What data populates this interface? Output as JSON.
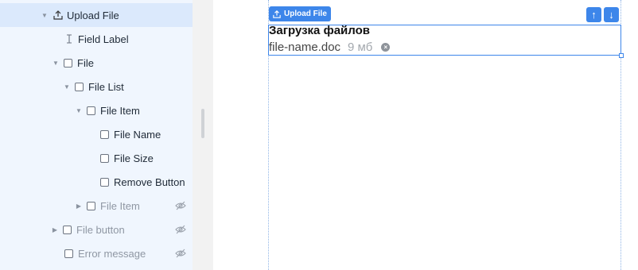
{
  "tree": {
    "items": [
      {
        "label": "Upload File",
        "icon": "upload-icon",
        "caret": true,
        "selected": true,
        "muted": false,
        "hidden": false
      },
      {
        "label": "Field Label",
        "icon": "text-cursor-icon",
        "caret": false,
        "selected": false,
        "muted": false,
        "hidden": false
      },
      {
        "label": "File",
        "icon": "box-icon",
        "caret": true,
        "selected": false,
        "muted": false,
        "hidden": false
      },
      {
        "label": "File List",
        "icon": "box-icon",
        "caret": true,
        "selected": false,
        "muted": false,
        "hidden": false
      },
      {
        "label": "File Item",
        "icon": "box-icon",
        "caret": true,
        "selected": false,
        "muted": false,
        "hidden": false
      },
      {
        "label": "File Name",
        "icon": "box-icon",
        "caret": false,
        "selected": false,
        "muted": false,
        "hidden": false
      },
      {
        "label": "File Size",
        "icon": "box-icon",
        "caret": false,
        "selected": false,
        "muted": false,
        "hidden": false
      },
      {
        "label": "Remove Button",
        "icon": "box-icon",
        "caret": false,
        "selected": false,
        "muted": false,
        "hidden": false
      },
      {
        "label": "File Item",
        "icon": "box-icon",
        "caret": true,
        "selected": false,
        "muted": true,
        "hidden": true
      },
      {
        "label": "File button",
        "icon": "box-icon",
        "caret": true,
        "selected": false,
        "muted": true,
        "hidden": true
      },
      {
        "label": "Error message",
        "icon": "box-icon",
        "caret": false,
        "selected": false,
        "muted": true,
        "hidden": true
      }
    ]
  },
  "canvas": {
    "component_tag": "Upload File",
    "upload_title": "Загрузка файлов",
    "file_name": "file-name.doc",
    "file_size": "9 мб",
    "move_up_label": "↑",
    "move_down_label": "↓"
  },
  "colors": {
    "accent": "#3d86ea",
    "tree_bg": "#f0f6fe",
    "selected_bg": "#dbe9fc"
  }
}
